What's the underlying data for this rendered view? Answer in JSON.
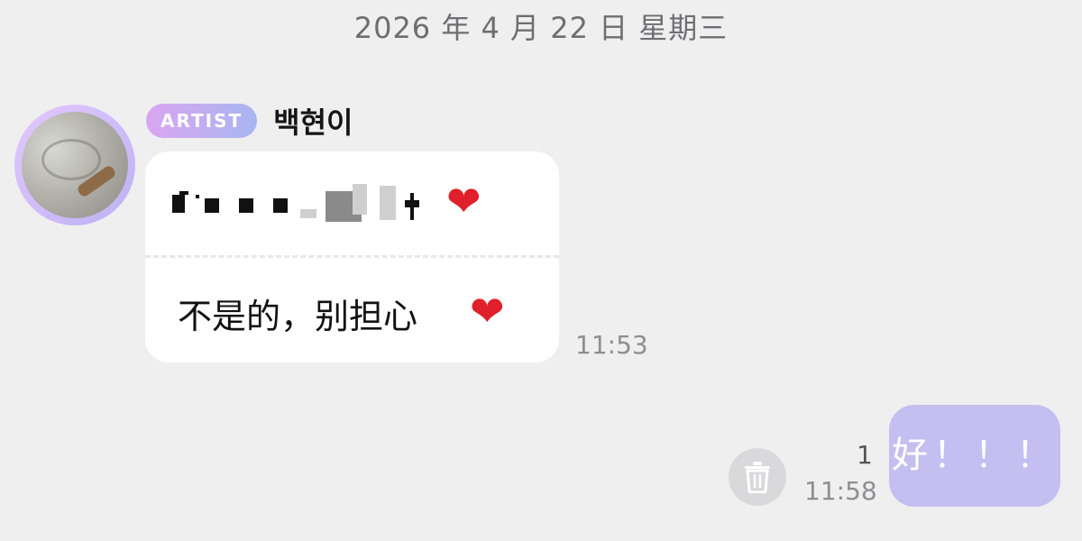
{
  "date_divider": "2026 年 4 月 22 日 星期三",
  "incoming": {
    "role_badge": "ARTIST",
    "sender_name": "백현이",
    "translation": "不是的，别担心",
    "heart_emoji": "❤",
    "time": "11:53"
  },
  "outgoing": {
    "text": "好！！！",
    "read_count": "1",
    "time": "11:58"
  },
  "colors": {
    "background": "#efeff0",
    "outgoing_bubble": "#c4bff0",
    "badge_gradient_start": "#d9a6f0",
    "badge_gradient_end": "#a8b6f0",
    "heart": "#e0202a"
  },
  "icons": {
    "delete": "trash-icon",
    "reaction": "heart-icon"
  }
}
